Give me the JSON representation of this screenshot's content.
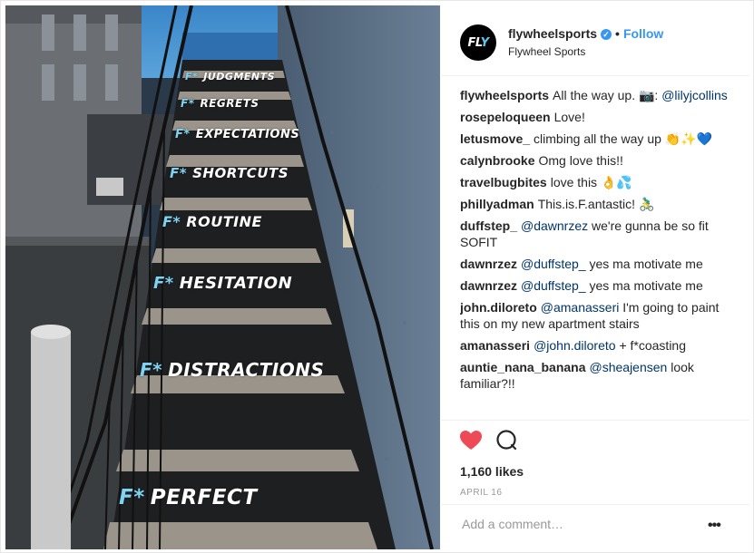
{
  "post": {
    "username": "flywheelsports",
    "verified_icon": "verified-badge-icon",
    "separator": "•",
    "follow_label": "Follow",
    "full_name": "Flywheel Sports",
    "avatar_text_a": "FL",
    "avatar_text_b": "Y",
    "accent_color": "#3897f0"
  },
  "photo": {
    "words": [
      "JUDGMENTS",
      "REGRETS",
      "EXPECTATIONS",
      "SHORTCUTS",
      "ROUTINE",
      "HESITATION",
      "DISTRACTIONS",
      "PERFECT"
    ],
    "prefix": "F*"
  },
  "comments": [
    {
      "user": "flywheelsports",
      "text": "All the way up. 📷: ",
      "mention": "@lilyjcollins",
      "after": ""
    },
    {
      "user": "rosepeloqueen",
      "text": "Love!",
      "mention": "",
      "after": ""
    },
    {
      "user": "letusmove_",
      "text": "climbing all the way up 👏✨💙",
      "mention": "",
      "after": ""
    },
    {
      "user": "calynbrooke",
      "text": "Omg love this!!",
      "mention": "",
      "after": ""
    },
    {
      "user": "travelbugbites",
      "text": "love this 👌💦",
      "mention": "",
      "after": ""
    },
    {
      "user": "phillyadman",
      "text": "This.is.F.antastic! 🚴‍♂️",
      "mention": "",
      "after": ""
    },
    {
      "user": "duffstep_",
      "text": "",
      "mention": "@dawnrzez",
      "after": " we're gunna be so fit SOFIT"
    },
    {
      "user": "dawnrzez",
      "text": "",
      "mention": "@duffstep_",
      "after": " yes ma motivate me"
    },
    {
      "user": "dawnrzez",
      "text": "",
      "mention": "@duffstep_",
      "after": " yes ma motivate me"
    },
    {
      "user": "john.diloreto",
      "text": "",
      "mention": "@amanasseri",
      "after": " I'm going to paint this on my new apartment stairs"
    },
    {
      "user": "amanasseri",
      "text": "",
      "mention": "@john.diloreto",
      "after": " + f*coasting"
    },
    {
      "user": "auntie_nana_banana",
      "text": "",
      "mention": "@sheajensen",
      "after": " look familiar?!!"
    }
  ],
  "actions": {
    "likes": "1,160 likes",
    "date": "APRIL 16",
    "heart_color": "#ed4956"
  },
  "add_comment": {
    "placeholder": "Add a comment…",
    "more": "•••"
  }
}
